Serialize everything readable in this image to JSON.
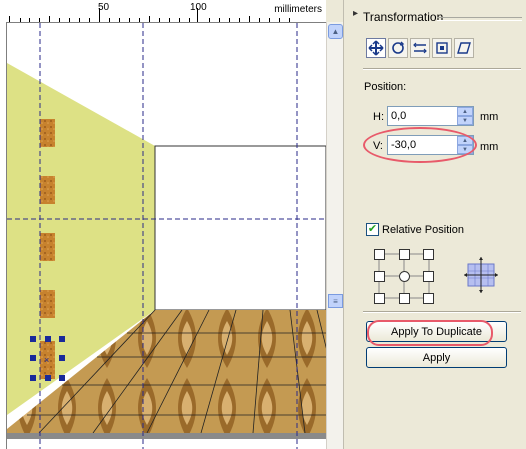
{
  "ruler": {
    "unit": "millimeters",
    "labels": [
      "50",
      "100"
    ]
  },
  "panel": {
    "title": "Transformation",
    "tools": [
      "position-icon",
      "rotate-icon",
      "scale-mirror-icon",
      "size-icon",
      "skew-icon"
    ],
    "section_label": "Position:",
    "h": {
      "label": "H:",
      "value": "0,0",
      "unit": "mm"
    },
    "v": {
      "label": "V:",
      "value": "-30,0",
      "unit": "mm"
    },
    "relative_position": {
      "label": "Relative Position",
      "checked": true
    },
    "apply_to_duplicate": "Apply To Duplicate",
    "apply": "Apply"
  },
  "colors": {
    "wall": "#dde185",
    "floor_wood": "#c49a52",
    "guide": "#2a2a88",
    "highlight": "#e85a6a"
  }
}
